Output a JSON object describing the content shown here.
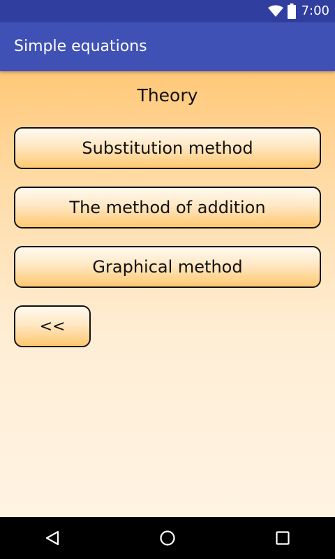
{
  "status_bar": {
    "time": "7:00",
    "icons": [
      "wifi-icon",
      "battery-icon"
    ],
    "color": "#303f9f"
  },
  "app_bar": {
    "title": "Simple equations",
    "color": "#3f51b5"
  },
  "main": {
    "heading": "Theory",
    "buttons": [
      {
        "label": "Substitution method"
      },
      {
        "label": "The method of addition"
      },
      {
        "label": "Graphical method"
      }
    ],
    "back_label": "<<"
  },
  "nav_bar": {
    "icons": [
      "back-triangle-icon",
      "home-circle-icon",
      "recents-square-icon"
    ]
  }
}
